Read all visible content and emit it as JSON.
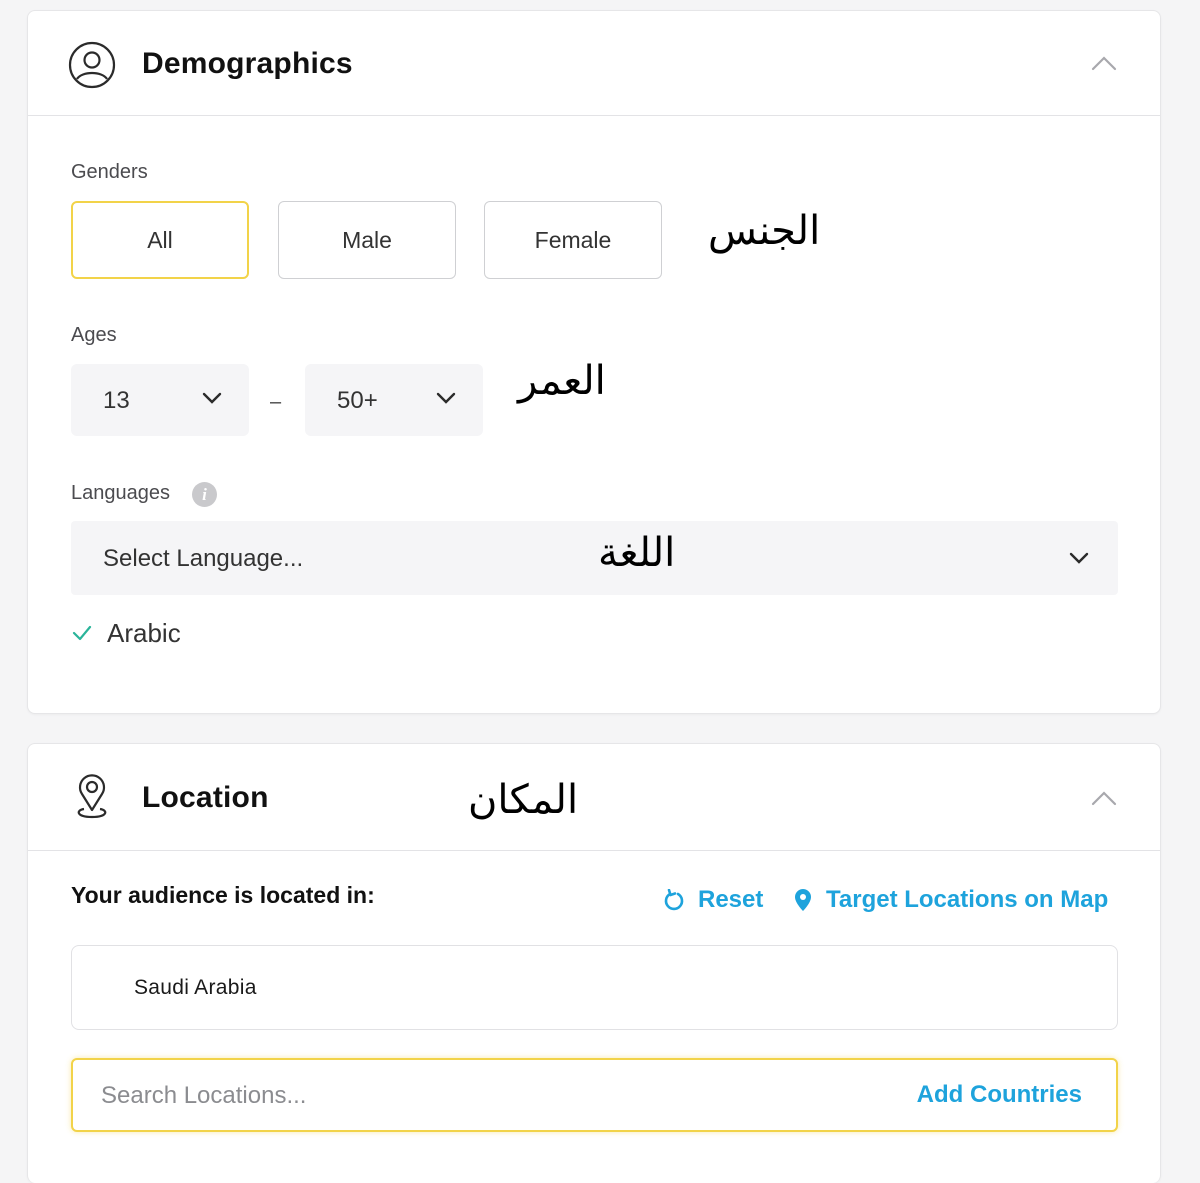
{
  "demographics": {
    "title": "Demographics",
    "icon": "user-circle-icon",
    "collapse_icon": "chevron-up-icon",
    "genders": {
      "label": "Genders",
      "options": [
        {
          "label": "All",
          "selected": true
        },
        {
          "label": "Male",
          "selected": false
        },
        {
          "label": "Female",
          "selected": false
        }
      ],
      "annotation_ar": "الجنس"
    },
    "ages": {
      "label": "Ages",
      "min": "13",
      "separator": "–",
      "max": "50+",
      "annotation_ar": "العمر"
    },
    "languages": {
      "label": "Languages",
      "info_icon": "info-icon",
      "placeholder": "Select Language...",
      "annotation_ar": "اللغة",
      "selected": [
        "Arabic"
      ],
      "check_color": "#2ab49a"
    }
  },
  "location": {
    "title": "Location",
    "icon": "map-pin-icon",
    "collapse_icon": "chevron-up-icon",
    "annotation_ar": "المكان",
    "audience_label": "Your audience is located in:",
    "reset_label": "Reset",
    "map_label": "Target Locations on Map",
    "locations": [
      "Saudi Arabia"
    ],
    "search_placeholder": "Search Locations...",
    "search_value": "",
    "add_label": "Add Countries"
  },
  "colors": {
    "accent_link": "#1ea3dc",
    "selected_border": "#f2d349",
    "field_bg": "#f5f5f7",
    "page_bg": "#f5f5f6"
  }
}
